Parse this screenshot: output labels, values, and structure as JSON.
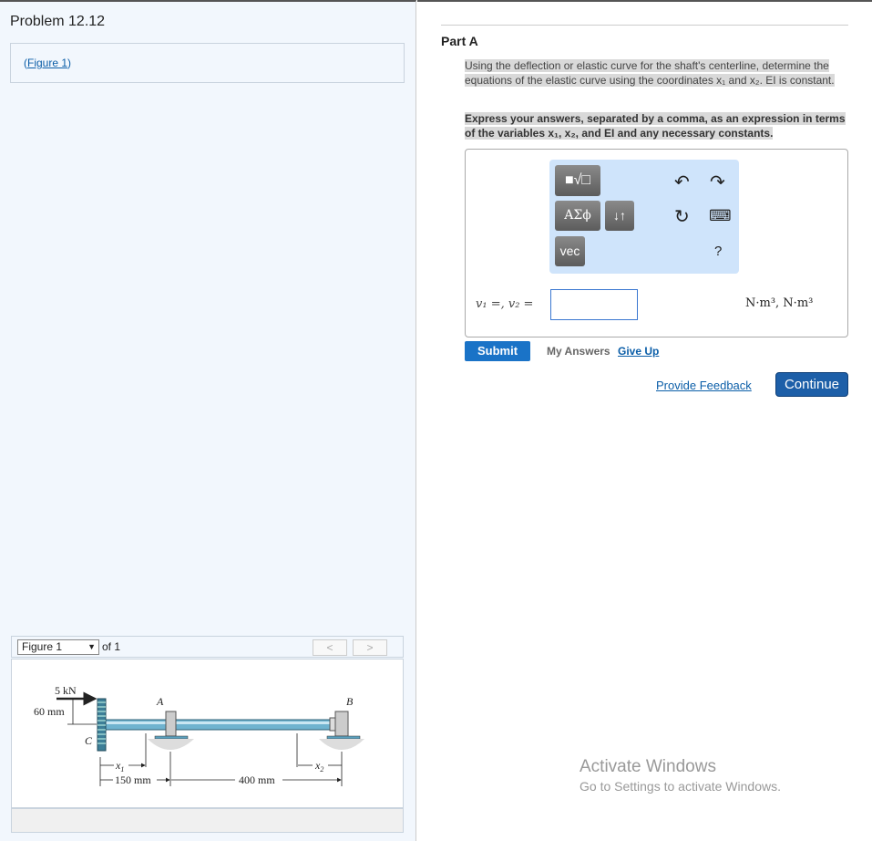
{
  "problem_title": "Problem 12.12",
  "figure_link": {
    "prefix": "(",
    "label": "Figure 1",
    "suffix": ")"
  },
  "figure_viewer": {
    "selected": "Figure 1",
    "of_label": "of 1",
    "prev": "<",
    "next": ">",
    "labels": {
      "force": "5 kN",
      "offset": "60 mm",
      "C": "C",
      "A": "A",
      "B": "B",
      "x1": "x",
      "x1_sub": "1",
      "x2": "x",
      "x2_sub": "2",
      "d1": "150 mm",
      "d2": "400 mm"
    }
  },
  "part": {
    "title": "Part A",
    "question": "Using the deflection or elastic curve for the shaft's centerline, determine the equations of the elastic curve using the coordinates x₁ and x₂. EI is constant.",
    "instruction": "Express your answers, separated by a comma, as an expression in terms of the variables x₁, x₂, and EI and any necessary constants."
  },
  "toolbar": {
    "templates": "■√□",
    "greek": "ΑΣϕ",
    "arrows": "↓↑",
    "vec": "vec",
    "undo": "↶",
    "redo": "↷",
    "reset": "↻",
    "keyboard": "⌨",
    "help": "?"
  },
  "answer": {
    "lhs": "v₁ =, v₂ =",
    "value": "",
    "units": "N·m³, N·m³"
  },
  "actions": {
    "submit": "Submit",
    "my_answers": "My Answers",
    "give_up": "Give Up",
    "feedback": "Provide Feedback",
    "continue": "Continue"
  },
  "watermark": {
    "line1": "Activate Windows",
    "line2": "Go to Settings to activate Windows."
  }
}
